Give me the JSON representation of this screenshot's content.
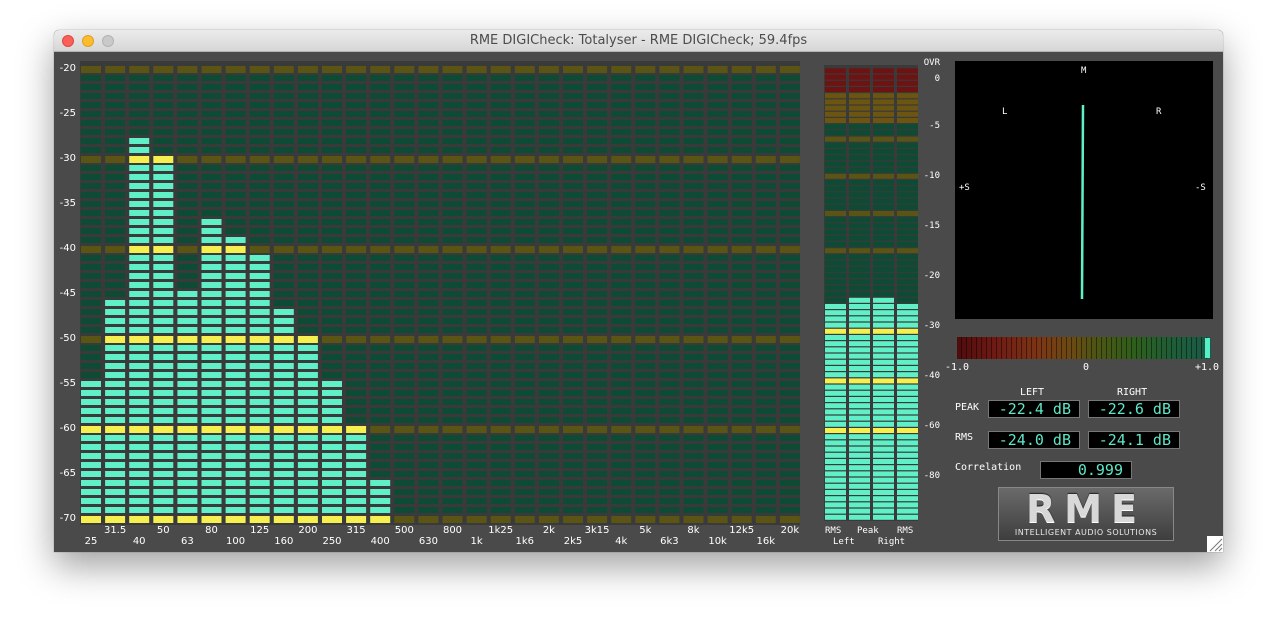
{
  "window": {
    "title": "RME DIGICheck: Totalyser - RME DIGICheck; 59.4fps"
  },
  "analyzer": {
    "y_axis_labels": [
      "-20",
      "-25",
      "-30",
      "-35",
      "-40",
      "-45",
      "-50",
      "-55",
      "-60",
      "-65",
      "-70"
    ],
    "band_labels": [
      "25",
      "31.5",
      "40",
      "50",
      "63",
      "80",
      "100",
      "125",
      "160",
      "200",
      "250",
      "315",
      "400",
      "500",
      "630",
      "800",
      "1k",
      "1k25",
      "1k6",
      "2k",
      "2k5",
      "3k15",
      "4k",
      "5k",
      "6k3",
      "8k",
      "10k",
      "12k5",
      "16k",
      "20k"
    ],
    "band_levels_db": [
      -55,
      -46,
      -28,
      -30,
      -45,
      -37,
      -39,
      -41,
      -47,
      -50,
      -55,
      -60,
      -66,
      -71,
      -71,
      -71,
      -71,
      -71,
      -71,
      -71,
      -71,
      -71,
      -71,
      -71,
      -71,
      -71,
      -71,
      -71,
      -71,
      -71
    ],
    "db_range": [
      -70,
      -20
    ]
  },
  "level_meters": {
    "scale_labels": [
      "OVR",
      "0",
      "-5",
      "-10",
      "-15",
      "-20",
      "-30",
      "-40",
      "-60",
      "-80"
    ],
    "column_labels": [
      "RMS",
      "Peak",
      "Peak",
      "RMS"
    ],
    "channel_labels": [
      "Left",
      "Right"
    ],
    "fill_levels": [
      0.485,
      0.495,
      0.495,
      0.475
    ]
  },
  "goniometer": {
    "label_m": "M",
    "label_l": "L",
    "label_r": "R",
    "label_plus_s": "+S",
    "label_minus_s": "-S"
  },
  "correlation_meter": {
    "scale_min": "-1.0",
    "scale_mid": "0",
    "scale_max": "+1.0",
    "value_fraction": 0.999
  },
  "readouts": {
    "left_header": "LEFT",
    "right_header": "RIGHT",
    "peak_label": "PEAK",
    "rms_label": "RMS",
    "peak_left": "-22.4 dB",
    "peak_right": "-22.6 dB",
    "rms_left": "-24.0 dB",
    "rms_right": "-24.1 dB",
    "correlation_label": "Correlation",
    "correlation_value": "0.999"
  },
  "logo": {
    "text": "RME",
    "tagline": "INTELLIGENT AUDIO SOLUTIONS"
  },
  "colors": {
    "bar_on": "#5ff0c8",
    "bar_off": "#0d4b35",
    "grid_major": "#5a5415",
    "highlight_on": "#f5f050",
    "panel": "#4a4a4a"
  }
}
